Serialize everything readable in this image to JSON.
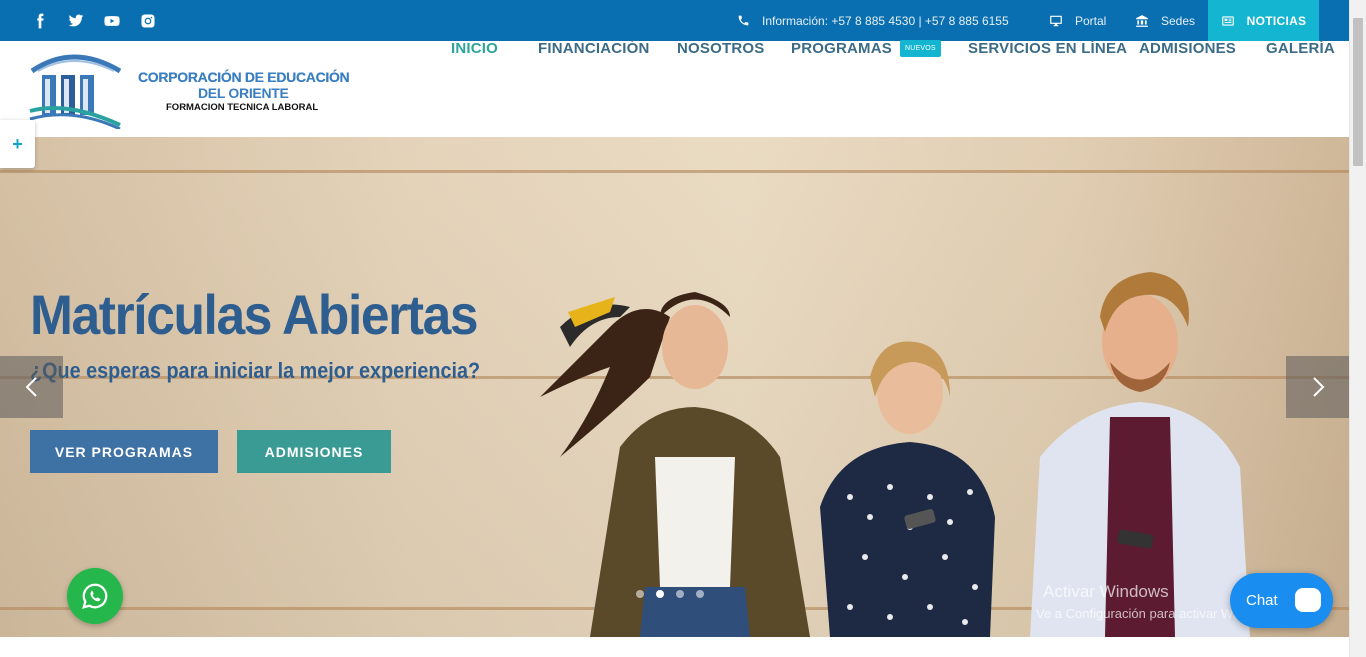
{
  "topbar": {
    "social": [
      "facebook-icon",
      "twitter-icon",
      "youtube-icon",
      "instagram-icon"
    ],
    "contact": "Información: +57 8 885 4530 | +57 8 885 6155",
    "portal": "Portal",
    "sedes": "Sedes",
    "noticias": "NOTICIAS"
  },
  "logo": {
    "line1": "CORPORACIÓN DE EDUCACIÓN",
    "line2": "DEL ORIENTE",
    "line3": "FORMACION TECNICA LABORAL"
  },
  "nav": {
    "items": [
      {
        "label": "INICIO",
        "active": true
      },
      {
        "label": "FINANCIACIÓN"
      },
      {
        "label": "NOSOTROS"
      },
      {
        "label": "PROGRAMAS",
        "badge": "NUEVOS"
      },
      {
        "label": "SERVICIOS EN LÍNEA"
      },
      {
        "label": "ADMISIONES"
      },
      {
        "label": "GALERÍA"
      }
    ]
  },
  "sidetab": "+",
  "hero": {
    "title": "Matrículas Abiertas",
    "subtitle": "¿Que esperas para iniciar la mejor experiencia?",
    "btn_programs": "VER PROGRAMAS",
    "btn_admissions": "ADMISIONES"
  },
  "overlay": {
    "watermark_title": "Activar Windows",
    "watermark_sub": "Ve a Configuración para activar Windows.",
    "chat": "Chat"
  },
  "colors": {
    "topbar": "#0a6fb0",
    "accent": "#13b5d1",
    "nav_text": "#3b6b86",
    "nav_active": "#2ca49c",
    "hero_title": "#2e5d90",
    "btn_blue": "#3e71a4",
    "btn_teal": "#3a9b95",
    "whatsapp": "#25b74b",
    "chat": "#1a8df0"
  }
}
